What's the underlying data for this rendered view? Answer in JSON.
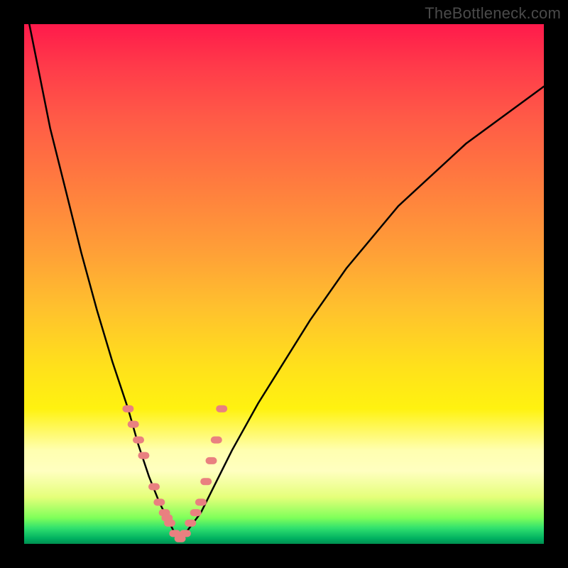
{
  "watermark": "TheBottleneck.com",
  "chart_data": {
    "type": "line",
    "title": "",
    "xlabel": "",
    "ylabel": "",
    "xlim": [
      0,
      100
    ],
    "ylim": [
      0,
      100
    ],
    "series": [
      {
        "name": "bottleneck-curve",
        "x": [
          1,
          3,
          5,
          8,
          11,
          14,
          17,
          20,
          22,
          24,
          26,
          28,
          29,
          30,
          31,
          34,
          37,
          40,
          45,
          50,
          55,
          62,
          72,
          85,
          100
        ],
        "values": [
          100,
          90,
          80,
          68,
          56,
          45,
          35,
          26,
          19,
          13,
          8,
          4,
          2,
          1,
          2,
          6,
          12,
          18,
          27,
          35,
          43,
          53,
          65,
          77,
          88
        ]
      }
    ],
    "markers": {
      "name": "data-points",
      "x": [
        20,
        21,
        22,
        23,
        25,
        26,
        27,
        27.5,
        28,
        29,
        30,
        31,
        32,
        33,
        34,
        35,
        36,
        37,
        38
      ],
      "values": [
        26,
        23,
        20,
        17,
        11,
        8,
        6,
        5,
        4,
        2,
        1,
        2,
        4,
        6,
        8,
        12,
        16,
        20,
        26
      ]
    },
    "colors": {
      "curve": "#000000",
      "marker": "#e98080"
    }
  }
}
